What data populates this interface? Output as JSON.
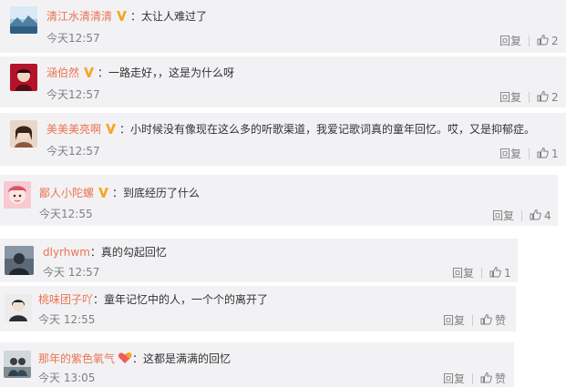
{
  "comments": [
    {
      "user": "清江水清清清",
      "sep": "：",
      "text": "太让人难过了",
      "time": "今天12:57",
      "reply": "回复",
      "likes": "2",
      "verified": true
    },
    {
      "user": "涵伯然",
      "sep": "：",
      "text": "一路走好，，这是为什么呀",
      "time": "今天12:57",
      "reply": "回复",
      "likes": "2",
      "verified": true
    },
    {
      "user": "美美美亮啊",
      "sep": "：",
      "text": "小时候没有像现在这么多的听歌渠道，我爱记歌词真的童年回忆。哎，又是抑郁症。",
      "time": "今天12:57",
      "reply": "回复",
      "likes": "1",
      "verified": true
    },
    {
      "user": "鄙人小陀螺",
      "sep": "：",
      "text": "到底经历了什么",
      "time": "今天12:55",
      "reply": "回复",
      "likes": "4",
      "verified": true
    },
    {
      "user": "dlyrhwm",
      "sep": "：",
      "text": "真的勾起回忆",
      "time": "今天 12:57",
      "reply": "回复",
      "likes": "1",
      "verified": false
    },
    {
      "user": "桃味团子吖",
      "sep": "：",
      "text": "童年记忆中的人，一个个的离开了",
      "time": "今天 12:55",
      "reply": "回复",
      "likes": "赞",
      "verified": false
    },
    {
      "user": "那年的紫色氧气",
      "sep": "：",
      "text": "这都是满满的回忆",
      "time": "今天 13:05",
      "reply": "回复",
      "likes": "赞",
      "verified": false,
      "badge": "heart"
    }
  ],
  "colors": {
    "username": "#eb7350",
    "card_bg": "#f2f2f5",
    "meta": "#808080",
    "badge_v": "#f5a623"
  },
  "icons": {
    "verified": "verified-v-icon",
    "like": "thumb-up-icon",
    "fan_badge": "heart-badge-icon"
  }
}
